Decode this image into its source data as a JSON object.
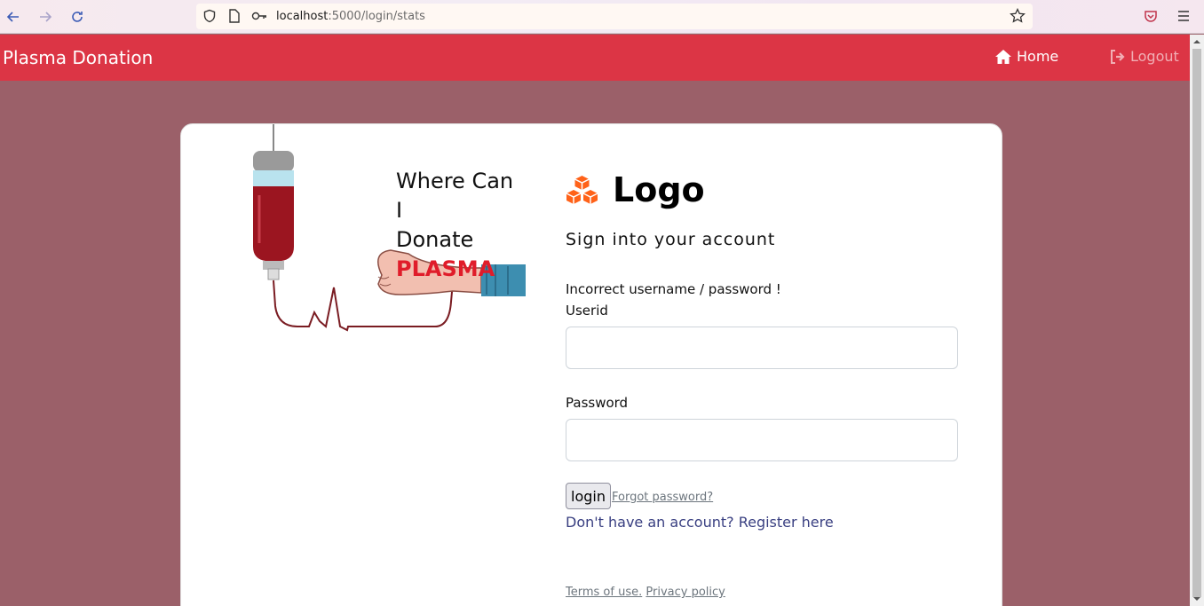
{
  "browser": {
    "url_host": "localhost",
    "url_path": ":5000/login/stats"
  },
  "navbar": {
    "brand": "Plasma Donation",
    "home_label": "Home",
    "logout_label": "Logout"
  },
  "illustration": {
    "line1": "Where Can I",
    "line2_prefix": "Donate ",
    "line2_highlight": "PLASMA"
  },
  "login": {
    "logo_text": "Logo",
    "subtitle": "Sign into your account",
    "error": "Incorrect username / password !",
    "userid_label": "Userid",
    "userid_value": "",
    "password_label": "Password",
    "password_value": "",
    "login_button": "login",
    "forgot_link": "Forgot password?",
    "register_link": "Don't have an account? Register here",
    "terms_link": "Terms of use.",
    "privacy_link": "Privacy policy"
  },
  "colors": {
    "navbar": "#dc3545",
    "background": "#9b6069",
    "logo_icon": "#ff6219",
    "register_link": "#393f81"
  }
}
